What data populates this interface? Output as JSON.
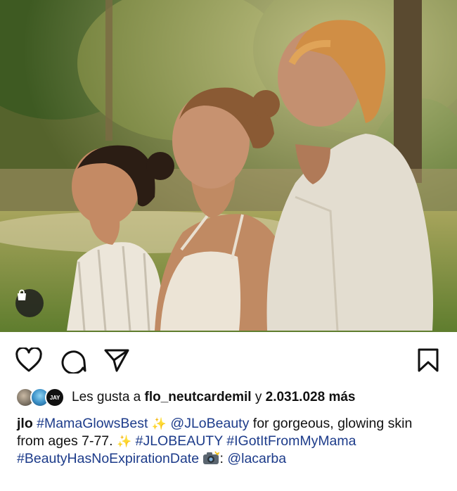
{
  "post": {
    "shopping_tag_icon": "shopping-bag-icon"
  },
  "actions": {
    "like_icon": "heart-icon",
    "comment_icon": "comment-bubble-icon",
    "share_icon": "paper-plane-icon",
    "save_icon": "bookmark-icon"
  },
  "likes": {
    "avatar_3_text": "JAY",
    "prefix": "Les gusta a",
    "user": "flo_neutcardemil",
    "joiner": "y",
    "count": "2.031.028 más"
  },
  "caption": {
    "username": "jlo",
    "hashtag_1": "#MamaGlowsBest",
    "sparkle": "✨",
    "mention_1": "@JLoBeauty",
    "text_1": "for gorgeous, glowing skin from ages 7-77.",
    "hashtag_2": "#JLOBEAUTY",
    "hashtag_3": "#IGotItFromMyMama",
    "hashtag_4": "#BeautyHasNoExpirationDate",
    "camera_emoji": "camera-flash-emoji",
    "colon": ":",
    "mention_2": "@lacarba"
  },
  "colors": {
    "link": "#1c3b8a",
    "text": "#111111",
    "background": "#ffffff"
  }
}
